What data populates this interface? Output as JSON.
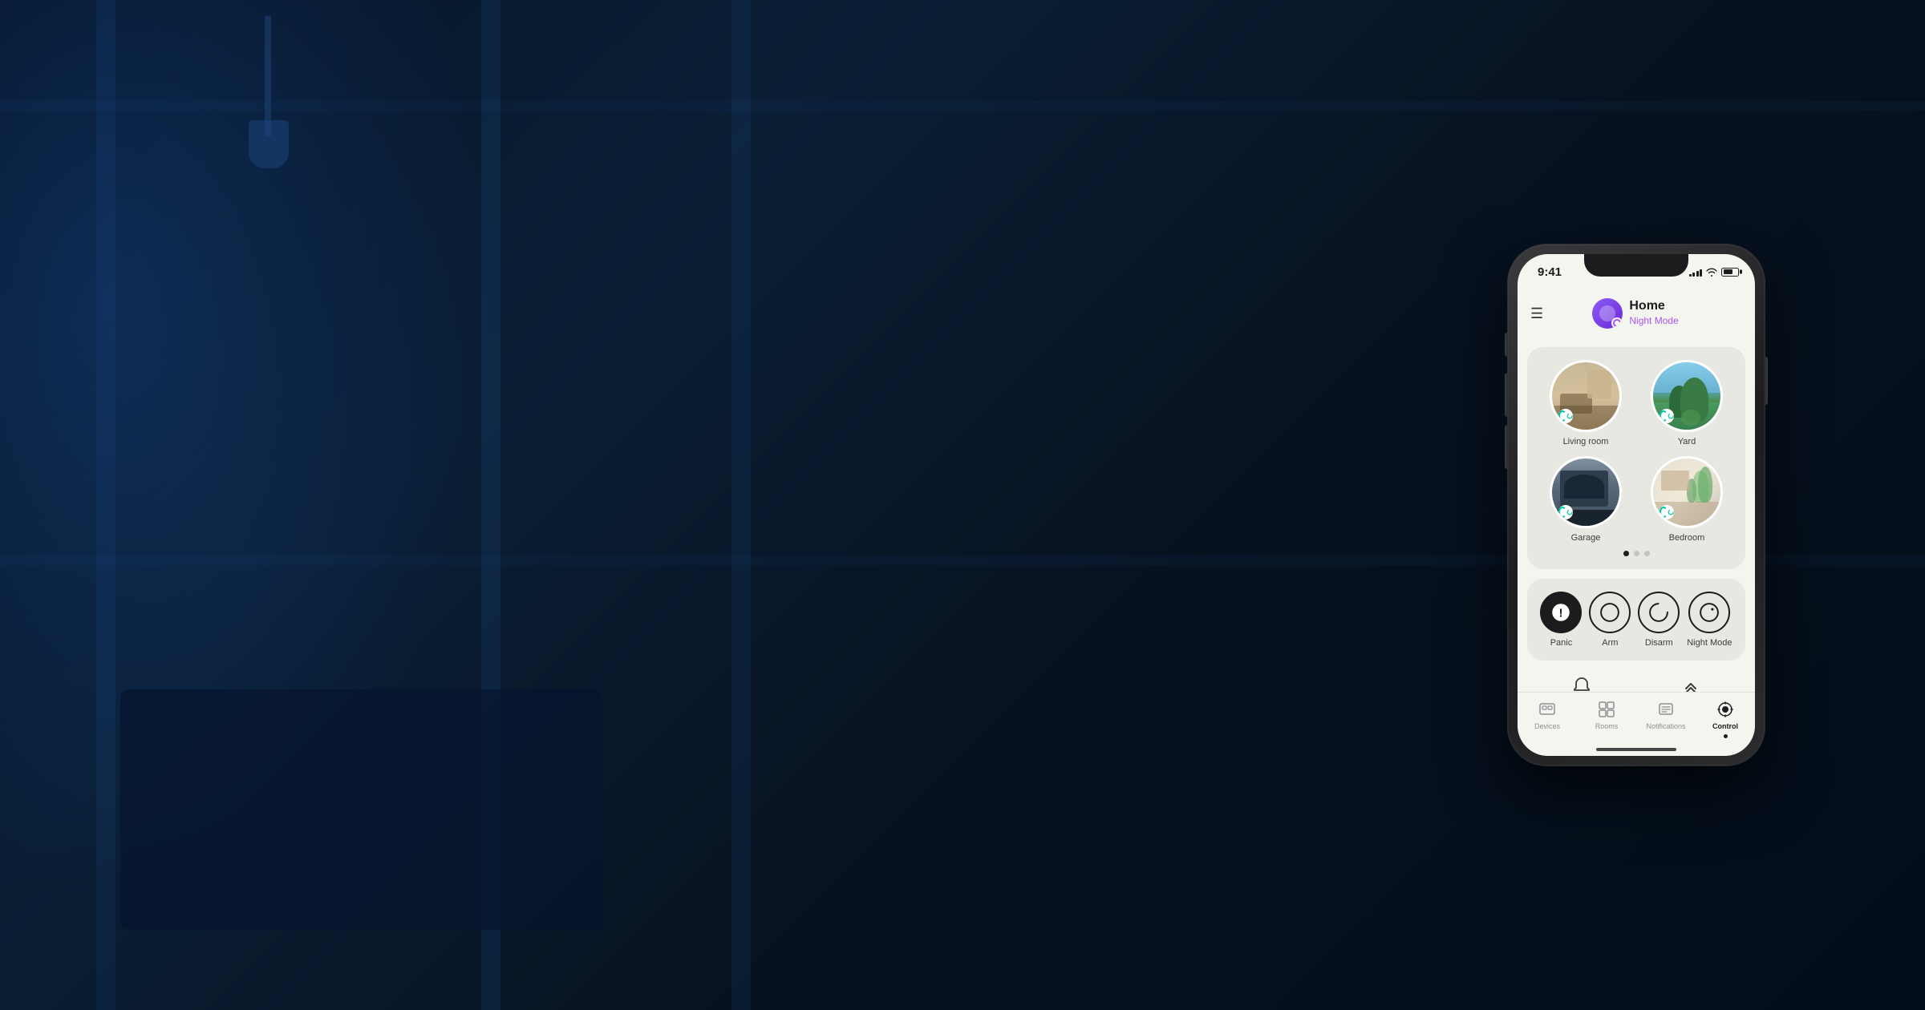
{
  "background": {
    "color": "#020d1f"
  },
  "phone": {
    "status_bar": {
      "time": "9:41",
      "signal": "full",
      "wifi": true,
      "battery": "70"
    },
    "header": {
      "menu_icon": "☰",
      "title": "Home",
      "subtitle": "Night Mode",
      "subtitle_color": "#a855f7"
    },
    "rooms": {
      "items": [
        {
          "label": "Living room",
          "type": "living"
        },
        {
          "label": "Yard",
          "type": "yard"
        },
        {
          "label": "Garage",
          "type": "garage"
        },
        {
          "label": "Bedroom",
          "type": "bedroom"
        }
      ],
      "pagination": {
        "active": 0,
        "total": 3
      }
    },
    "security": {
      "controls": [
        {
          "id": "panic",
          "label": "Panic",
          "icon": "panic"
        },
        {
          "id": "arm",
          "label": "Arm",
          "icon": "arm"
        },
        {
          "id": "disarm",
          "label": "Disarm",
          "icon": "disarm"
        },
        {
          "id": "night-mode",
          "label": "Night Mode",
          "icon": "night"
        }
      ]
    },
    "quick_access": {
      "bell_label": "",
      "arrow_label": ""
    },
    "bottom_nav": {
      "items": [
        {
          "id": "devices",
          "label": "Devices",
          "active": false
        },
        {
          "id": "rooms",
          "label": "Rooms",
          "active": false
        },
        {
          "id": "notifications",
          "label": "Notifications",
          "active": false
        },
        {
          "id": "control",
          "label": "Control",
          "active": true
        }
      ]
    }
  }
}
